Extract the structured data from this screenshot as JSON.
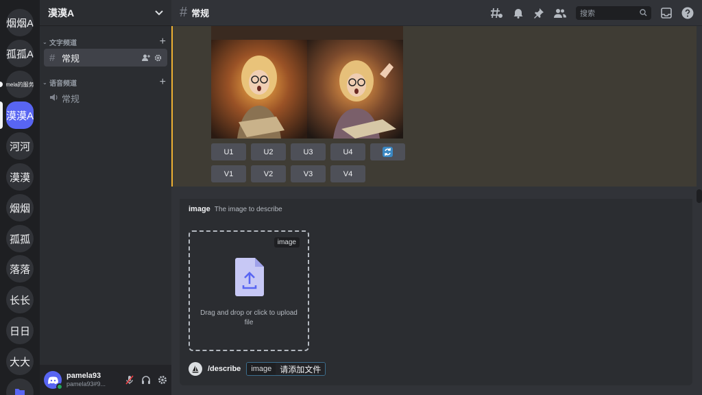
{
  "servers": [
    {
      "label": "烟烟A",
      "active": false,
      "small": false
    },
    {
      "label": "孤孤A",
      "active": false,
      "small": false
    },
    {
      "label": "mela的服务",
      "active": false,
      "small": true
    },
    {
      "label": "漠漠A",
      "active": true,
      "small": false
    },
    {
      "label": "河河",
      "active": false,
      "small": false
    },
    {
      "label": "漠漠",
      "active": false,
      "small": false
    },
    {
      "label": "烟烟",
      "active": false,
      "small": false
    },
    {
      "label": "孤孤",
      "active": false,
      "small": false
    },
    {
      "label": "落落",
      "active": false,
      "small": false
    },
    {
      "label": "长长",
      "active": false,
      "small": false
    },
    {
      "label": "日日",
      "active": false,
      "small": false
    },
    {
      "label": "大大",
      "active": false,
      "small": false
    }
  ],
  "sidebar": {
    "server_name": "漠漠A",
    "text_category": "文字频道",
    "voice_category": "语音频道",
    "text_channel": "常规",
    "voice_channel": "常规"
  },
  "user": {
    "name": "pamela93",
    "tag": "pamela93#9..."
  },
  "topbar": {
    "channel": "常规",
    "search_placeholder": "搜索"
  },
  "message": {
    "upscale_buttons": [
      "U1",
      "U2",
      "U3",
      "U4"
    ],
    "variation_buttons": [
      "V1",
      "V2",
      "V3",
      "V4"
    ]
  },
  "command": {
    "option_name": "image",
    "option_description": "The image to describe",
    "upload_tag": "image",
    "upload_hint": "Drag and drop or click to upload file",
    "slash": "/describe",
    "param_key": "image",
    "param_value": "请添加文件"
  },
  "colors": {
    "accent": "#5865f2",
    "highlight_bar": "#f0b232",
    "online": "#23a55a"
  }
}
